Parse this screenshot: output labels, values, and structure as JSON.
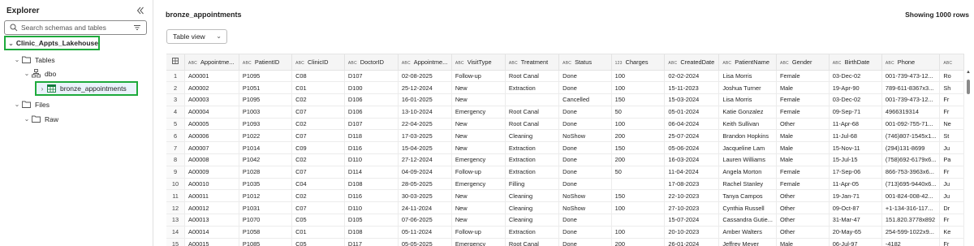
{
  "explorer": {
    "title": "Explorer",
    "search_placeholder": "Search schemas and tables",
    "lakehouse": "Clinic_Appts_Lakehouse",
    "tables_label": "Tables",
    "schema": "dbo",
    "table": "bronze_appointments",
    "files_label": "Files",
    "raw_label": "Raw"
  },
  "main": {
    "title": "bronze_appointments",
    "row_count": "Showing 1000 rows",
    "view_button": "Table view"
  },
  "grid": {
    "columns": [
      {
        "type": "ABC",
        "name": "Appointme..."
      },
      {
        "type": "ABC",
        "name": "PatientID"
      },
      {
        "type": "ABC",
        "name": "ClinicID"
      },
      {
        "type": "ABC",
        "name": "DoctorID"
      },
      {
        "type": "ABC",
        "name": "Appointme..."
      },
      {
        "type": "ABC",
        "name": "VisitType"
      },
      {
        "type": "ABC",
        "name": "Treatment"
      },
      {
        "type": "ABC",
        "name": "Status"
      },
      {
        "type": "123",
        "name": "Charges"
      },
      {
        "type": "ABC",
        "name": "CreatedDate"
      },
      {
        "type": "ABC",
        "name": "PatientName"
      },
      {
        "type": "ABC",
        "name": "Gender"
      },
      {
        "type": "ABC",
        "name": "BirthDate"
      },
      {
        "type": "ABC",
        "name": "Phone"
      },
      {
        "type": "ABC",
        "name": ""
      }
    ],
    "rows": [
      [
        "1",
        "A00001",
        "P1095",
        "C08",
        "D107",
        "02-08-2025",
        "Follow-up",
        "Root Canal",
        "Done",
        "100",
        "02-02-2024",
        "Lisa Morris",
        "Female",
        "03-Dec-02",
        "001-739-473-12...",
        "Ro"
      ],
      [
        "2",
        "A00002",
        "P1051",
        "C01",
        "D100",
        "25-12-2024",
        "New",
        "Extraction",
        "Done",
        "100",
        "15-11-2023",
        "Joshua Turner",
        "Male",
        "19-Apr-90",
        "789-611-8367x3...",
        "Sh"
      ],
      [
        "3",
        "A00003",
        "P1095",
        "C02",
        "D106",
        "16-01-2025",
        "New",
        "",
        "Cancelled",
        "150",
        "15-03-2024",
        "Lisa Morris",
        "Female",
        "03-Dec-02",
        "001-739-473-12...",
        "Fr"
      ],
      [
        "4",
        "A00004",
        "P1003",
        "C07",
        "D106",
        "13-10-2024",
        "Emergency",
        "Root Canal",
        "Done",
        "50",
        "05-01-2024",
        "Katie Gonzalez",
        "Female",
        "09-Sep-71",
        "4966319314",
        "Fr"
      ],
      [
        "5",
        "A00005",
        "P1093",
        "C02",
        "D107",
        "22-04-2025",
        "New",
        "Root Canal",
        "Done",
        "100",
        "06-04-2024",
        "Keith Sullivan",
        "Other",
        "11-Apr-68",
        "001-092-755-71...",
        "Ne"
      ],
      [
        "6",
        "A00006",
        "P1022",
        "C07",
        "D118",
        "17-03-2025",
        "New",
        "Cleaning",
        "NoShow",
        "200",
        "25-07-2024",
        "Brandon Hopkins",
        "Male",
        "11-Jul-68",
        "(746)807-1545x1...",
        "St"
      ],
      [
        "7",
        "A00007",
        "P1014",
        "C09",
        "D116",
        "15-04-2025",
        "New",
        "Extraction",
        "Done",
        "150",
        "05-06-2024",
        "Jacqueline Lam",
        "Male",
        "15-Nov-11",
        "(294)131-8699",
        "Ju"
      ],
      [
        "8",
        "A00008",
        "P1042",
        "C02",
        "D110",
        "27-12-2024",
        "Emergency",
        "Extraction",
        "Done",
        "200",
        "16-03-2024",
        "Lauren Williams",
        "Male",
        "15-Jul-15",
        "(758)692-6179x6...",
        "Pa"
      ],
      [
        "9",
        "A00009",
        "P1028",
        "C07",
        "D114",
        "04-09-2024",
        "Follow-up",
        "Extraction",
        "Done",
        "50",
        "11-04-2024",
        "Angela Morton",
        "Female",
        "17-Sep-06",
        "866-753-3963x6...",
        "Fr"
      ],
      [
        "10",
        "A00010",
        "P1035",
        "C04",
        "D108",
        "28-05-2025",
        "Emergency",
        "Filling",
        "Done",
        "",
        "17-08-2023",
        "Rachel Stanley",
        "Female",
        "11-Apr-05",
        "(713)695-9440x6...",
        "Ju"
      ],
      [
        "11",
        "A00011",
        "P1012",
        "C02",
        "D116",
        "30-03-2025",
        "New",
        "Cleaning",
        "NoShow",
        "150",
        "22-10-2023",
        "Tanya Campos",
        "Other",
        "19-Jan-71",
        "001-824-008-42...",
        "Ju"
      ],
      [
        "12",
        "A00012",
        "P1031",
        "C07",
        "D110",
        "24-11-2024",
        "New",
        "Cleaning",
        "NoShow",
        "100",
        "27-10-2023",
        "Cynthia Russell",
        "Other",
        "09-Oct-87",
        "+1-134-316-117...",
        "Dr"
      ],
      [
        "13",
        "A00013",
        "P1070",
        "C05",
        "D105",
        "07-06-2025",
        "New",
        "Cleaning",
        "Done",
        "",
        "15-07-2024",
        "Cassandra Gutie...",
        "Other",
        "31-Mar-47",
        "151.820.3778x892",
        "Fr"
      ],
      [
        "14",
        "A00014",
        "P1058",
        "C01",
        "D108",
        "05-11-2024",
        "Follow-up",
        "Extraction",
        "Done",
        "100",
        "20-10-2023",
        "Amber Walters",
        "Other",
        "20-May-65",
        "254-599-1022x9...",
        "Ke"
      ],
      [
        "15",
        "A00015",
        "P1085",
        "C05",
        "D117",
        "05-05-2025",
        "Emergency",
        "Root Canal",
        "Done",
        "200",
        "26-01-2024",
        "Jeffrey Meyer",
        "Male",
        "06-Jul-97",
        "-4182",
        "Fr"
      ]
    ]
  }
}
